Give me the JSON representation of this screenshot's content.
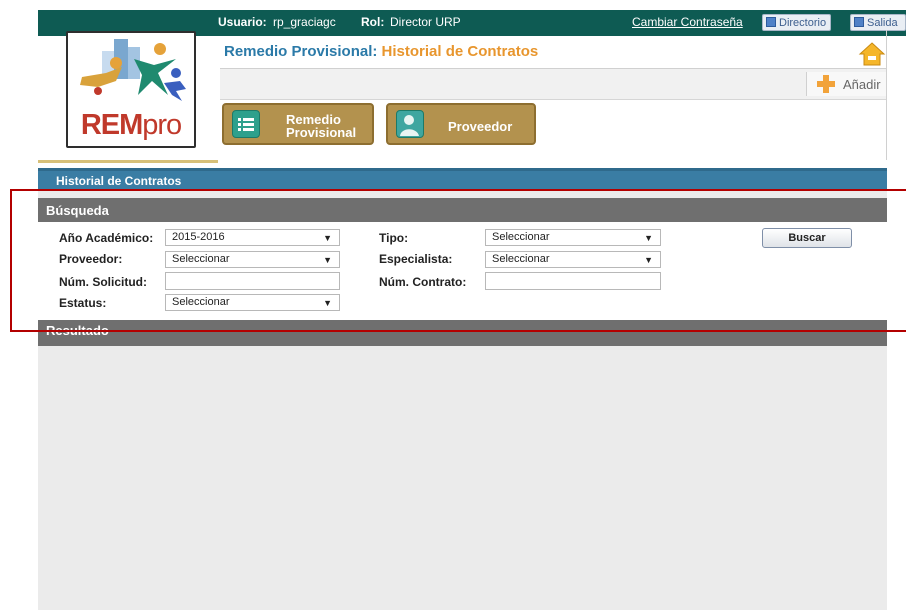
{
  "topbar": {
    "user_label": "Usuario:",
    "user_value": "rp_graciagc",
    "role_label": "Rol:",
    "role_value": "Director URP",
    "change_password": "Cambiar Contraseña",
    "directory": "Directorio",
    "exit": "Salida"
  },
  "logo": {
    "text_main": "REM",
    "text_pro": "pro"
  },
  "title": {
    "main": "Remedio Provisional:",
    "sub": "Historial de Contratos"
  },
  "toolbar": {
    "add_label": "Añadir"
  },
  "modules": [
    {
      "label_line1": "Remedio",
      "label_line2": "Provisional"
    },
    {
      "label": "Proveedor"
    }
  ],
  "section_title": "Historial de Contratos",
  "search": {
    "title": "Búsqueda",
    "ano_label": "Año Académico:",
    "ano_value": "2015-2016",
    "tipo_label": "Tipo:",
    "tipo_value": "Seleccionar",
    "proveedor_label": "Proveedor:",
    "proveedor_value": "Seleccionar",
    "especialista_label": "Especialista:",
    "especialista_value": "Seleccionar",
    "solicitud_label": "Núm. Solicitud:",
    "solicitud_value": "",
    "contrato_label": "Núm. Contrato:",
    "contrato_value": "",
    "estatus_label": "Estatus:",
    "estatus_value": "Seleccionar",
    "buscar_label": "Buscar"
  },
  "results": {
    "title": "Resultado"
  },
  "colors": {
    "topbar": "#0e5b53",
    "title_blue": "#2b7aa8",
    "title_orange": "#e8962e",
    "module_gold": "#b3924e",
    "highlight": "#b30000"
  }
}
